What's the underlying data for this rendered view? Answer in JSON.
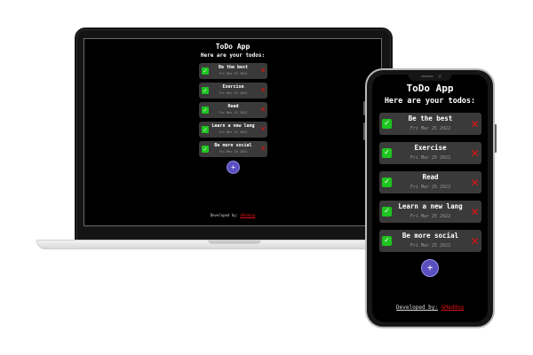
{
  "app": {
    "title": "ToDo App",
    "subtitle": "Here are your todos:",
    "add_symbol": "+",
    "footer_prefix": "Developed by:",
    "footer_author": "&Maddog",
    "colors": {
      "accent": "#5a4fc0",
      "check": "#1ec51e",
      "delete": "#e01010",
      "card": "#3a3a3a"
    }
  },
  "todos": [
    {
      "name": "Be the best",
      "date": "Fri Mar 25 2022"
    },
    {
      "name": "Exercise",
      "date": "Fri Mar 25 2022"
    },
    {
      "name": "Read",
      "date": "Fri Mar 25 2022"
    },
    {
      "name": "Learn a new lang",
      "date": "Fri Mar 25 2022"
    },
    {
      "name": "Be more social",
      "date": "Fri Mar 25 2022"
    }
  ],
  "icons": {
    "check": "check-icon",
    "delete": "delete-x-icon",
    "add": "plus-icon"
  },
  "glyphs": {
    "check": "✓",
    "delete": "✕"
  }
}
